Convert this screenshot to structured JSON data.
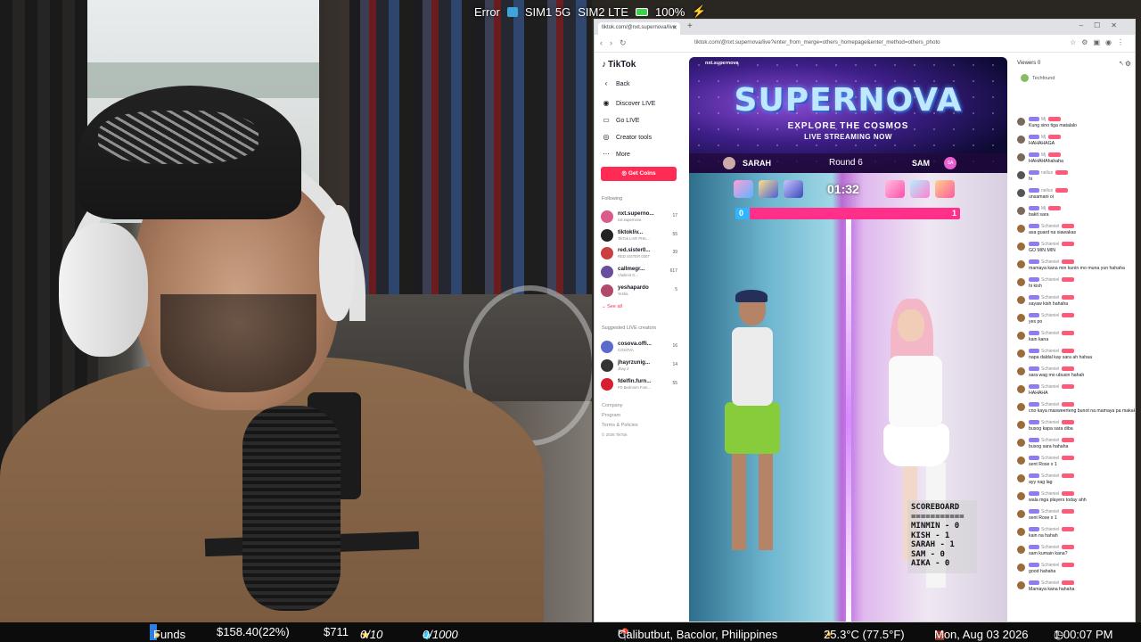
{
  "status_overlay": {
    "error": "Error",
    "sim1": "SIM1 5G",
    "sim2": "SIM2 LTE",
    "battery": "100%"
  },
  "browser": {
    "tab_title": "tiktok.com/@nxt.supernova/live",
    "url": "tiktok.com/@nxt.supernova/live?enter_from_merge=others_homepage&enter_method=others_photo"
  },
  "tiktok": {
    "logo": "TikTok",
    "nav": [
      {
        "label": "Back",
        "icon": "arrow-left-icon"
      },
      {
        "label": "Discover LIVE",
        "icon": "live-icon"
      },
      {
        "label": "Go LIVE",
        "icon": "camera-icon"
      },
      {
        "label": "Creator tools",
        "icon": "tools-icon"
      },
      {
        "label": "More",
        "icon": "more-icon"
      }
    ],
    "get_coins": "Get Coins",
    "following_label": "Following",
    "following": [
      {
        "name": "nxt.superno...",
        "sub": "nxt.supernova",
        "count": "17",
        "color": "#d95d8b"
      },
      {
        "name": "tiktokliv...",
        "sub": "TikTok LIVE PHIL...",
        "count": "55",
        "color": "#222"
      },
      {
        "name": "red.sister0...",
        "sub": "RED SISTER 0307",
        "count": "39",
        "color": "#c94040"
      },
      {
        "name": "callmegr...",
        "sub": "Vladimir G...",
        "count": "617",
        "color": "#6a4e9d"
      },
      {
        "name": "yeshapardo",
        "sub": "Yesha",
        "count": "5",
        "color": "#b04a6b"
      }
    ],
    "see_all": "See all",
    "suggested_label": "Suggested LIVE creators",
    "suggested": [
      {
        "name": "cosova.offi...",
        "sub": "COSOVA",
        "count": "16",
        "color": "#5b6acb"
      },
      {
        "name": "jhayrzunig...",
        "sub": "Jhay Z",
        "count": "14",
        "color": "#333"
      },
      {
        "name": "fdelfin.furn...",
        "sub": "FD Bedroom Furn...",
        "count": "55",
        "color": "#d6202f"
      }
    ],
    "footer": [
      "Company",
      "Program",
      "Terms & Policies",
      "© 2026 TikTok"
    ]
  },
  "live": {
    "host": "nxt.supernova",
    "banner_title": "SUPERNOVA",
    "banner_sub1": "EXPLORE THE COSMOS",
    "banner_sub2": "LIVE STREAMING NOW",
    "player_left": "SARAH",
    "round": "Round 6",
    "player_right": "SAM",
    "player_right_badge": "SA",
    "timer": "01:32",
    "score_left": "0",
    "score_right": "1",
    "score_share_left": 0.06,
    "scoreboard": [
      "SCOREBOARD",
      "===========",
      "MINMIN - 0",
      "KISH - 1",
      "SARAH - 1",
      "SAM - 0",
      "AIKA - 0"
    ]
  },
  "chat": {
    "viewers": "Viewers 0",
    "top_viewer": "Techfound",
    "messages": [
      {
        "name": "Mj",
        "text": "Kung sino tiga matalalo",
        "color": "#7a6a5a"
      },
      {
        "name": "Mj",
        "text": "HAHAHAGA",
        "color": "#7a6a5a"
      },
      {
        "name": "Mj",
        "text": "HAHAHAhahaha",
        "color": "#7a6a5a"
      },
      {
        "name": "nellux",
        "text": "hi",
        "color": "#555"
      },
      {
        "name": "nellux",
        "text": "unsamani oi",
        "color": "#555"
      },
      {
        "name": "Mj",
        "text": "bakit sara",
        "color": "#7a6a5a"
      },
      {
        "name": "Schieniel",
        "text": "asa guard na siawakas",
        "color": "#9b6b3c"
      },
      {
        "name": "Schieniel",
        "text": "GO MIN MIN",
        "color": "#9b6b3c"
      },
      {
        "name": "Schieniel",
        "text": "mamaya kana min kunin mo muna yun hahaha",
        "color": "#9b6b3c"
      },
      {
        "name": "Schieniel",
        "text": "hi kish",
        "color": "#9b6b3c"
      },
      {
        "name": "Schieniel",
        "text": "sayaw kish hahaha",
        "color": "#9b6b3c"
      },
      {
        "name": "Schieniel",
        "text": "yes po",
        "color": "#9b6b3c"
      },
      {
        "name": "Schieniel",
        "text": "kain kana",
        "color": "#9b6b3c"
      },
      {
        "name": "Schieniel",
        "text": "napa daldal kay sara ah hahaa",
        "color": "#9b6b3c"
      },
      {
        "name": "Schieniel",
        "text": "sara wag mo ubusin hahah",
        "color": "#9b6b3c"
      },
      {
        "name": "Schieniel",
        "text": "HAHAHA",
        "color": "#9b6b3c"
      },
      {
        "name": "Schieniel",
        "text": "cno kaya masweerteng bunot na mamaya pa makaka kain",
        "color": "#9b6b3c"
      },
      {
        "name": "Schieniel",
        "text": "busog kapa sara diba",
        "color": "#9b6b3c"
      },
      {
        "name": "Schieniel",
        "text": "busog sara hahaha",
        "color": "#9b6b3c"
      },
      {
        "name": "Schieniel",
        "text": "sent Rose x 1",
        "color": "#9b6b3c"
      },
      {
        "name": "Schieniel",
        "text": "ayy nag lag",
        "color": "#9b6b3c"
      },
      {
        "name": "Schieniel",
        "text": "wala mga players today ahh",
        "color": "#9b6b3c"
      },
      {
        "name": "Schieniel",
        "text": "sent Rose x 1",
        "color": "#9b6b3c"
      },
      {
        "name": "Schieniel",
        "text": "kain na hahah",
        "color": "#9b6b3c"
      },
      {
        "name": "Schieniel",
        "text": "sam kumain kana?",
        "color": "#9b6b3c"
      },
      {
        "name": "Schieniel",
        "text": "good hahaha",
        "color": "#9b6b3c"
      },
      {
        "name": "Schieniel",
        "text": "Mamaya kana hahaha",
        "color": "#9b6b3c"
      }
    ]
  },
  "ticker": {
    "funds": "Funds",
    "balance": "$158.40(22%)",
    "amount": "$711",
    "stars": "0/10",
    "gems": "0/1000",
    "location": "Calibutbut, Bacolor, Philippines",
    "country": "PH",
    "weather": "25.3°C (77.5°F)",
    "date": "Mon, Aug 03 2026",
    "time": "1:00:07 PM"
  }
}
